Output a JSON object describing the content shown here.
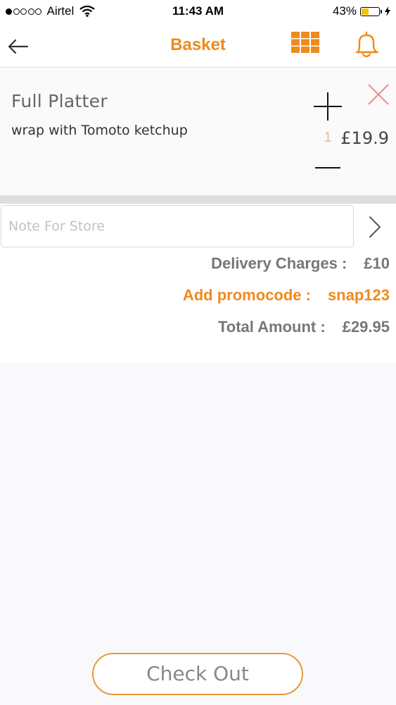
{
  "status_bar": {
    "carrier": "Airtel",
    "time": "11:43 AM",
    "battery": "43%",
    "battery_level": 0.43,
    "signal_bars": 1,
    "signal_total": 5
  },
  "nav": {
    "title": "Basket",
    "back_icon": "back-arrow-icon",
    "grid_icon": "grid-icon",
    "bell_icon": "bell-icon"
  },
  "item": {
    "name": "Full Platter",
    "description": "wrap with Tomoto ketchup",
    "quantity": "1",
    "price": "£19.9"
  },
  "note": {
    "placeholder": "Note For Store",
    "value": ""
  },
  "summary": {
    "delivery_label": "Delivery Charges :",
    "delivery_value": "£10",
    "promo_label": "Add promocode :",
    "promo_value": "snap123",
    "total_label": "Total Amount :",
    "total_value": "£29.95"
  },
  "checkout": {
    "label": "Check Out"
  },
  "colors": {
    "accent": "#ef8a1c",
    "remove": "#f08a8a",
    "quantity": "#f3b98a",
    "checkout_border": "#e39a3c"
  }
}
